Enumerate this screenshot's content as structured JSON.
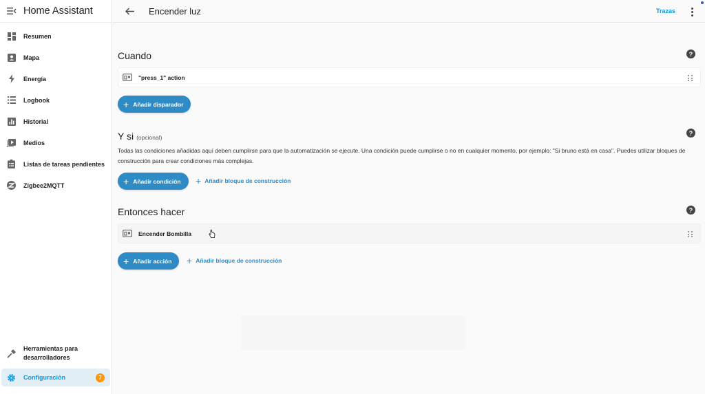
{
  "app": {
    "title": "Home Assistant"
  },
  "sidebar": {
    "items": [
      {
        "label": "Resumen",
        "icon": "dashboard-icon"
      },
      {
        "label": "Mapa",
        "icon": "map-icon"
      },
      {
        "label": "Energía",
        "icon": "lightning-icon"
      },
      {
        "label": "Logbook",
        "icon": "list-icon"
      },
      {
        "label": "Historial",
        "icon": "chart-bar-icon"
      },
      {
        "label": "Medios",
        "icon": "play-box-icon"
      },
      {
        "label": "Listas de tareas pendientes",
        "icon": "clipboard-list-icon"
      },
      {
        "label": "Zigbee2MQTT",
        "icon": "zigbee-icon"
      }
    ],
    "developer_tools": {
      "line1": "Herramientas para",
      "line2": "desarrolladores",
      "icon": "hammer-icon"
    },
    "config": {
      "label": "Configuración",
      "icon": "gear-icon",
      "badge": "7"
    }
  },
  "topbar": {
    "title": "Encender luz",
    "traces": "Trazas"
  },
  "sections": {
    "when": {
      "title": "Cuando",
      "row_label": "\"press_1\" action",
      "add_label": "Añadir disparador"
    },
    "and_if": {
      "title": "Y si",
      "subtitle": "(opcional)",
      "description": "Todas las condiciones añadidas aquí deben cumplirse para que la automatización se ejecute. Una condición puede cumplirse o no en cualquier momento, por ejemplo: \"Si bruno está en casa\". Puedes utilizar bloques de construcción para crear condiciones más complejas.",
      "add_label": "Añadir condición",
      "block_label": "Añadir bloque de construcción"
    },
    "then_do": {
      "title": "Entonces hacer",
      "row_label": "Encender Bombilla",
      "add_label": "Añadir acción",
      "block_label": "Añadir bloque de construcción"
    }
  },
  "colors": {
    "accent": "#039be5",
    "button": "#2e8bc6",
    "badge": "#ff9800"
  }
}
